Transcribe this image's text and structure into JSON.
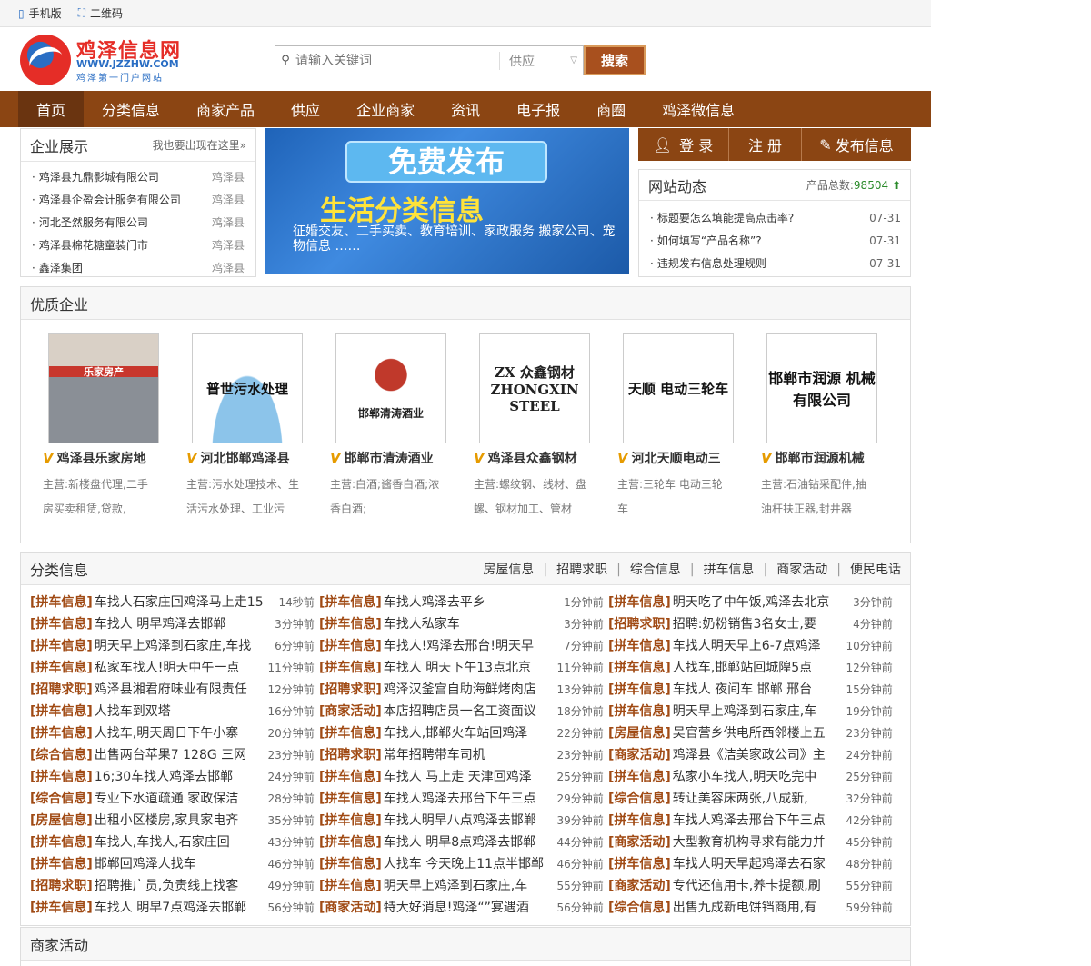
{
  "topbar": {
    "mobile": "手机版",
    "qrcode": "二维码"
  },
  "logo": {
    "title": "鸡泽信息网",
    "url": "WWW.JZZHW.COM",
    "slogan": "鸡泽第一门户网站"
  },
  "search": {
    "placeholder": "请输入关键词",
    "select": "供应",
    "button": "搜索"
  },
  "nav": [
    "首页",
    "分类信息",
    "商家产品",
    "供应",
    "企业商家",
    "资讯",
    "电子报",
    "商圈",
    "鸡泽微信息"
  ],
  "company_show": {
    "title": "企业展示",
    "more": "我也要出现在这里»",
    "items": [
      {
        "name": "鸡泽县九鼎影城有限公司",
        "city": "鸡泽县"
      },
      {
        "name": "鸡泽县企盈会计服务有限公司",
        "city": "鸡泽县"
      },
      {
        "name": "河北圣然服务有限公司",
        "city": "鸡泽县"
      },
      {
        "name": "鸡泽县棉花糖童装门市",
        "city": "鸡泽县"
      },
      {
        "name": "鑫泽集团",
        "city": "鸡泽县"
      }
    ]
  },
  "banner": {
    "line1": "免费发布",
    "line2": "生活分类信息",
    "line3": "征婚交友、二手买卖、教育培训、家政服务 搬家公司、宠物信息 ……"
  },
  "account": {
    "login": "登 录",
    "register": "注 册",
    "publish": "发布信息"
  },
  "site_news": {
    "title": "网站动态",
    "count_label": "产品总数:",
    "count": "98504",
    "items": [
      {
        "text": "标题要怎么填能提高点击率?",
        "date": "07-31"
      },
      {
        "text": "如何填写“产品名称”?",
        "date": "07-31"
      },
      {
        "text": "违规发布信息处理规则",
        "date": "07-31"
      }
    ]
  },
  "quality": {
    "title": "优质企业",
    "cards": [
      {
        "img": "乐家房产",
        "name": "鸡泽县乐家房地",
        "desc": "主营:新楼盘代理,二手房买卖租赁,贷款,"
      },
      {
        "img": "普世污水处理",
        "name": "河北邯郸鸡泽县",
        "desc": "主营:污水处理技术、生活污水处理、工业污"
      },
      {
        "img": "邯郸清涛酒业",
        "name": "邯郸市清涛酒业",
        "desc": "主营:白酒;酱香白酒;浓香白酒;"
      },
      {
        "img": "ZX 众鑫钢材 ZHONGXIN STEEL",
        "name": "鸡泽县众鑫钢材",
        "desc": "主营:螺纹钢、线材、盘螺、钢材加工、管材"
      },
      {
        "img": "天顺 电动三轮车",
        "name": "河北天顺电动三",
        "desc": "主营:三轮车 电动三轮车"
      },
      {
        "img": "邯郸市润源 机械有限公司",
        "name": "邯郸市润源机械",
        "desc": "主营:石油钻采配件,抽油杆扶正器,封井器"
      }
    ]
  },
  "category": {
    "title": "分类信息",
    "links": [
      "房屋信息",
      "招聘求职",
      "综合信息",
      "拼车信息",
      "商家活动",
      "便民电话"
    ],
    "columns": [
      [
        {
          "tag": "[拼车信息]",
          "text": "车找人石家庄回鸡泽马上走15",
          "time": "14秒前"
        },
        {
          "tag": "[拼车信息]",
          "text": "车找人 明早鸡泽去邯郸",
          "time": "3分钟前"
        },
        {
          "tag": "[拼车信息]",
          "text": "明天早上鸡泽到石家庄,车找",
          "time": "6分钟前"
        },
        {
          "tag": "[拼车信息]",
          "text": "私家车找人!明天中午一点",
          "time": "11分钟前"
        },
        {
          "tag": "[招聘求职]",
          "text": "鸡泽县湘君府味业有限责任",
          "time": "12分钟前"
        },
        {
          "tag": "[拼车信息]",
          "text": "人找车到双塔",
          "time": "16分钟前"
        },
        {
          "tag": "[拼车信息]",
          "text": "人找车,明天周日下午小寨",
          "time": "20分钟前"
        },
        {
          "tag": "[综合信息]",
          "text": "出售两台苹果7 128G 三网",
          "time": "23分钟前"
        },
        {
          "tag": "[拼车信息]",
          "text": "16;30车找人鸡泽去邯郸",
          "time": "24分钟前"
        },
        {
          "tag": "[综合信息]",
          "text": "专业下水道疏通 家政保洁",
          "time": "28分钟前"
        },
        {
          "tag": "[房屋信息]",
          "text": "出租小区楼房,家具家电齐",
          "time": "35分钟前"
        },
        {
          "tag": "[拼车信息]",
          "text": "车找人,车找人,石家庄回",
          "time": "43分钟前"
        },
        {
          "tag": "[拼车信息]",
          "text": "邯郸回鸡泽人找车",
          "time": "46分钟前"
        },
        {
          "tag": "[招聘求职]",
          "text": "招聘推广员,负责线上找客",
          "time": "49分钟前"
        },
        {
          "tag": "[拼车信息]",
          "text": "车找人 明早7点鸡泽去邯郸",
          "time": "56分钟前"
        }
      ],
      [
        {
          "tag": "[拼车信息]",
          "text": "车找人鸡泽去平乡",
          "time": "1分钟前"
        },
        {
          "tag": "[拼车信息]",
          "text": "车找人私家车",
          "time": "3分钟前"
        },
        {
          "tag": "[拼车信息]",
          "text": "车找人!鸡泽去邢台!明天早",
          "time": "7分钟前"
        },
        {
          "tag": "[拼车信息]",
          "text": "车找人 明天下午13点北京",
          "time": "11分钟前"
        },
        {
          "tag": "[招聘求职]",
          "text": "鸡泽汉釜宫自助海鲜烤肉店",
          "time": "13分钟前"
        },
        {
          "tag": "[商家活动]",
          "text": "本店招聘店员一名工资面议",
          "time": "18分钟前"
        },
        {
          "tag": "[拼车信息]",
          "text": "车找人,邯郸火车站回鸡泽",
          "time": "22分钟前"
        },
        {
          "tag": "[招聘求职]",
          "text": "常年招聘带车司机",
          "time": "23分钟前"
        },
        {
          "tag": "[拼车信息]",
          "text": "车找人 马上走 天津回鸡泽",
          "time": "25分钟前"
        },
        {
          "tag": "[拼车信息]",
          "text": "车找人鸡泽去邢台下午三点",
          "time": "29分钟前"
        },
        {
          "tag": "[拼车信息]",
          "text": "车找人明早八点鸡泽去邯郸",
          "time": "39分钟前"
        },
        {
          "tag": "[拼车信息]",
          "text": "车找人 明早8点鸡泽去邯郸",
          "time": "44分钟前"
        },
        {
          "tag": "[拼车信息]",
          "text": "人找车 今天晚上11点半邯郸",
          "time": "46分钟前"
        },
        {
          "tag": "[拼车信息]",
          "text": "明天早上鸡泽到石家庄,车",
          "time": "55分钟前"
        },
        {
          "tag": "[商家活动]",
          "text": "特大好消息!鸡泽“”宴遇酒",
          "time": "56分钟前"
        }
      ],
      [
        {
          "tag": "[拼车信息]",
          "text": "明天吃了中午饭,鸡泽去北京",
          "time": "3分钟前"
        },
        {
          "tag": "[招聘求职]",
          "text": "招聘:奶粉销售3名女士,要",
          "time": "4分钟前"
        },
        {
          "tag": "[拼车信息]",
          "text": "车找人明天早上6-7点鸡泽",
          "time": "10分钟前"
        },
        {
          "tag": "[拼车信息]",
          "text": "人找车,邯郸站回城隍5点",
          "time": "12分钟前"
        },
        {
          "tag": "[拼车信息]",
          "text": "车找人 夜间车 邯郸 邢台",
          "time": "15分钟前"
        },
        {
          "tag": "[拼车信息]",
          "text": "明天早上鸡泽到石家庄,车",
          "time": "19分钟前"
        },
        {
          "tag": "[房屋信息]",
          "text": "吴官营乡供电所西邻楼上五",
          "time": "23分钟前"
        },
        {
          "tag": "[商家活动]",
          "text": "鸡泽县《洁美家政公司》主",
          "time": "24分钟前"
        },
        {
          "tag": "[拼车信息]",
          "text": "私家小车找人,明天吃完中",
          "time": "25分钟前"
        },
        {
          "tag": "[综合信息]",
          "text": "转让美容床两张,八成新,",
          "time": "32分钟前"
        },
        {
          "tag": "[拼车信息]",
          "text": "车找人鸡泽去邢台下午三点",
          "time": "42分钟前"
        },
        {
          "tag": "[商家活动]",
          "text": "大型教育机构寻求有能力并",
          "time": "45分钟前"
        },
        {
          "tag": "[拼车信息]",
          "text": "车找人明天早起鸡泽去石家",
          "time": "48分钟前"
        },
        {
          "tag": "[商家活动]",
          "text": "专代还信用卡,养卡提额,刷",
          "time": "55分钟前"
        },
        {
          "tag": "[综合信息]",
          "text": "出售九成新电饼铛商用,有",
          "time": "59分钟前"
        }
      ]
    ]
  },
  "merchant": {
    "title": "商家活动"
  },
  "colors": {
    "brand": "#8b4513",
    "tag": "#a04a14",
    "logo_red": "#e52d27",
    "logo_blue": "#2a6ec4"
  }
}
